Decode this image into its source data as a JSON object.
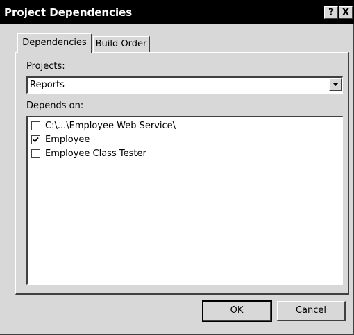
{
  "window": {
    "title": "Project Dependencies",
    "help_label": "?",
    "close_label": "X"
  },
  "tabs": [
    {
      "label": "Dependencies",
      "active": true
    },
    {
      "label": "Build Order",
      "active": false
    }
  ],
  "projects": {
    "label": "Projects:",
    "selected": "Reports"
  },
  "depends_on": {
    "label": "Depends on:",
    "items": [
      {
        "label": "C:\\...\\Employee Web Service\\",
        "checked": false
      },
      {
        "label": "Employee",
        "checked": true
      },
      {
        "label": "Employee Class Tester",
        "checked": false
      }
    ]
  },
  "buttons": {
    "ok": "OK",
    "cancel": "Cancel"
  },
  "icons": {
    "dropdown": "chevron-down-icon",
    "help": "help-icon",
    "close": "close-icon",
    "check": "check-icon"
  }
}
